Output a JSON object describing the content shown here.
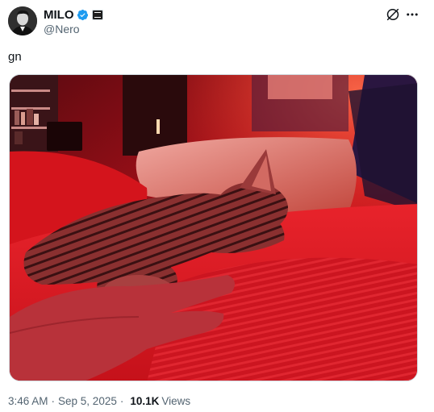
{
  "author": {
    "display_name": "MILO",
    "handle": "@Nero",
    "verified_color": "#1d9bf0"
  },
  "tweet": {
    "text": "gn"
  },
  "media": {
    "icon": "image",
    "dominant_color": "#d4141c"
  },
  "meta": {
    "time": "3:46 AM",
    "separator": "·",
    "date": "Sep 5, 2025",
    "views_count": "10.1K",
    "views_label": "Views"
  },
  "icons": {
    "grok": "grok-icon",
    "more": "more-icon",
    "verified": "verified-badge-icon",
    "affiliate": "affiliate-badge-icon"
  }
}
